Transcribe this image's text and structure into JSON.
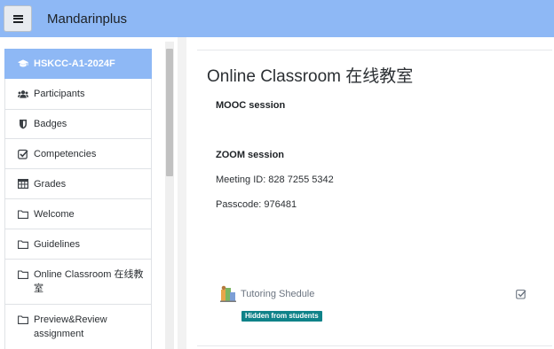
{
  "header": {
    "app_title": "Mandarinplus",
    "menu_icon": "hamburger-icon"
  },
  "sidebar": {
    "items": [
      {
        "label": "HSKCC-A1-2024F",
        "icon": "graduation-cap-icon",
        "active": true
      },
      {
        "label": "Participants",
        "icon": "users-icon"
      },
      {
        "label": "Badges",
        "icon": "shield-icon"
      },
      {
        "label": "Competencies",
        "icon": "checkbox-icon"
      },
      {
        "label": "Grades",
        "icon": "table-icon"
      },
      {
        "label": "Welcome",
        "icon": "folder-icon"
      },
      {
        "label": "Guidelines",
        "icon": "folder-icon"
      },
      {
        "label": "Online Classroom 在线教室",
        "icon": "folder-icon"
      },
      {
        "label": "Preview&Review assignment",
        "icon": "folder-icon"
      }
    ]
  },
  "main": {
    "title": "Online Classroom 在线教室",
    "mooc_heading": "MOOC session",
    "zoom_heading": "ZOOM session",
    "meeting_id": "Meeting ID: 828 7255 5342",
    "passcode": "Passcode: 976481",
    "activity": {
      "name": "Tutoring Shedule",
      "icon": "scheduler-icon",
      "restriction_badge": "Hidden from students",
      "completion_icon": "checkbox-icon"
    }
  },
  "colors": {
    "header_bg": "#8eb8f5",
    "active_item_bg": "#8eb8f5",
    "badge_bg": "#0f8289"
  }
}
